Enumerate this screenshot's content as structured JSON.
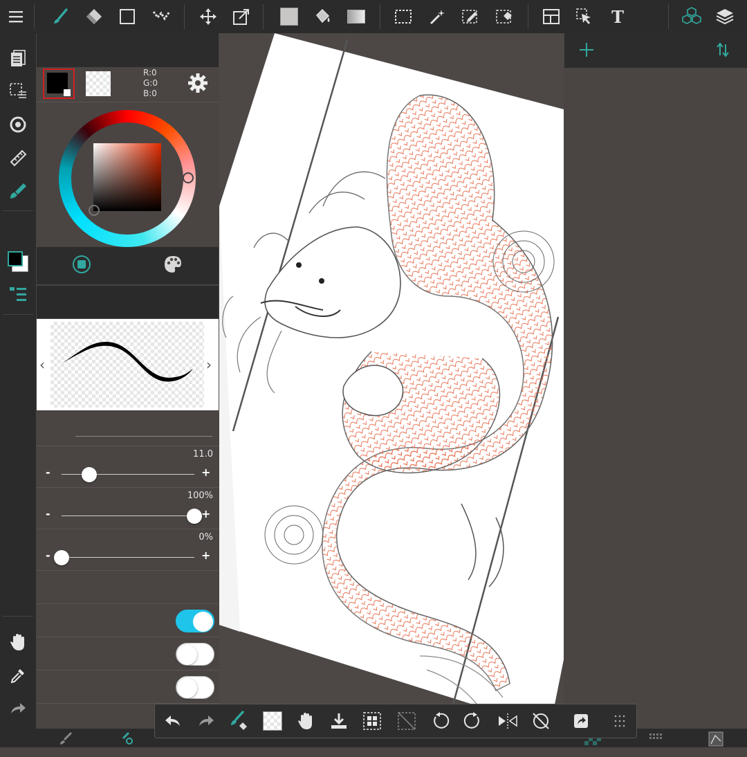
{
  "toolbar": {
    "icons": [
      "menu-icon",
      "brush-icon",
      "eraser-icon",
      "shape-icon",
      "dot-icon",
      "move-icon",
      "transform-icon",
      "fill-color-icon",
      "bucket-icon",
      "gradient-icon",
      "select-rect-icon",
      "magic-wand-icon",
      "select-pen-icon",
      "select-eraser-icon",
      "panel-icon",
      "select-arrow-icon",
      "text-icon",
      "3d-icon",
      "layers-icon"
    ],
    "text_tool_label": "T"
  },
  "color": {
    "main": "#000000",
    "rgb_r": "R:0",
    "rgb_g": "G:0",
    "rgb_b": "B:0"
  },
  "brush": {
    "sliders": [
      {
        "value_label": "11.0",
        "level": 0.21
      },
      {
        "value_label": "100%",
        "level": 1.0
      },
      {
        "value_label": "0%",
        "level": 0.0
      }
    ],
    "toggles": [
      {
        "on": true
      },
      {
        "on": false
      },
      {
        "on": false
      }
    ],
    "minus": "-",
    "plus": "+"
  },
  "bottom_bar": {
    "icons": [
      "undo-icon",
      "redo-icon",
      "brush-eraser-toggle-icon",
      "clear-icon",
      "hand-icon",
      "save-icon",
      "grid-select-icon",
      "no-transform-icon",
      "rotate-left-icon",
      "rotate-right-icon",
      "flip-icon",
      "reset-rotation-icon",
      "share-icon",
      "more-icon"
    ]
  },
  "colors": {
    "accent": "#31a8a0",
    "toggle_on": "#1fc4ea"
  }
}
